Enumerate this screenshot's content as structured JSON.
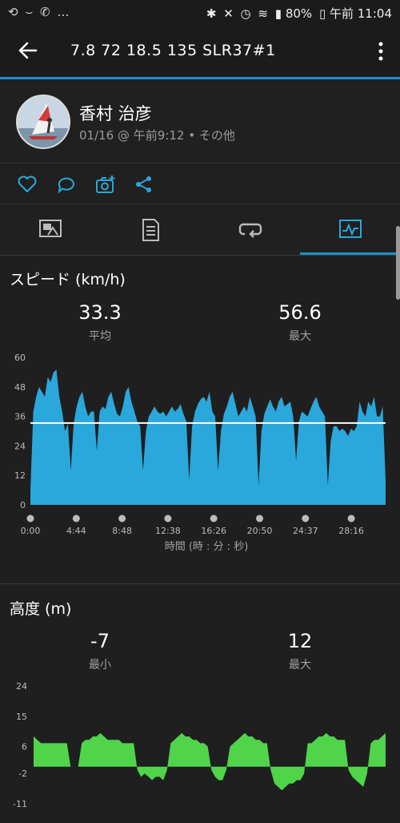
{
  "status_bar": {
    "left_icons": [
      "missed-call-icon",
      "refresh-icon",
      "call-forward-icon",
      "more-dots"
    ],
    "battery": "80%",
    "time": "午前 11:04"
  },
  "app_bar": {
    "title": "7.8  72  18.5   135  SLR37#1"
  },
  "profile": {
    "name": "香村 治彦",
    "meta": "01/16 @ 午前9:12 • その他"
  },
  "colors": {
    "accent": "#1a8fcf",
    "speed_fill": "#2aa7db",
    "elev_fill": "#4fd44a",
    "avg_line": "#ffffff"
  },
  "speed": {
    "title": "スピード (km/h)",
    "avg_value": "33.3",
    "avg_label": "平均",
    "max_value": "56.6",
    "max_label": "最大",
    "chart_data": {
      "type": "area",
      "ylim": [
        0,
        60
      ],
      "yticks": [
        "60",
        "48",
        "36",
        "24",
        "12",
        "0"
      ],
      "xticks": [
        "0:00",
        "4:44",
        "8:48",
        "12:38",
        "16:26",
        "20:50",
        "24:37",
        "28:16"
      ],
      "xlabel": "時間 (時 : 分 : 秒)",
      "average": 33.3,
      "values": [
        6,
        38,
        44,
        48,
        46,
        44,
        52,
        50,
        54,
        55,
        44,
        38,
        30,
        33,
        14,
        33,
        40,
        44,
        46,
        40,
        36,
        38,
        38,
        22,
        38,
        40,
        39,
        44,
        46,
        41,
        37,
        36,
        40,
        46,
        48,
        42,
        38,
        34,
        32,
        14,
        30,
        36,
        38,
        40,
        38,
        37,
        38,
        36,
        38,
        40,
        38,
        39,
        41,
        37,
        34,
        10,
        32,
        38,
        41,
        43,
        44,
        42,
        46,
        38,
        36,
        14,
        30,
        37,
        40,
        44,
        46,
        41,
        36,
        38,
        40,
        38,
        44,
        40,
        36,
        8,
        30,
        37,
        40,
        43,
        40,
        38,
        42,
        44,
        40,
        41,
        42,
        36,
        18,
        34,
        38,
        37,
        36,
        39,
        42,
        44,
        40,
        38,
        36,
        8,
        26,
        32,
        32,
        30,
        31,
        30,
        28,
        31,
        30,
        32,
        42,
        38,
        36,
        42,
        40,
        44,
        36,
        36,
        40,
        10
      ]
    }
  },
  "elevation": {
    "title": "高度 (m)",
    "min_value": "-7",
    "min_label": "最小",
    "max_value": "12",
    "max_label": "最大",
    "chart_data": {
      "type": "area",
      "ylim": [
        -11,
        24
      ],
      "yticks": [
        "24",
        "15",
        "6",
        "-2",
        "-11"
      ],
      "values": [
        9,
        8,
        7,
        7,
        7,
        7,
        7,
        7,
        7,
        7,
        0,
        0,
        0,
        7,
        8,
        8,
        9,
        9,
        10,
        9,
        8,
        8,
        8,
        8,
        7,
        7,
        7,
        7,
        -1,
        -3,
        -2,
        -3,
        -4,
        -3,
        -3,
        -4,
        -1,
        7,
        8,
        9,
        10,
        9,
        9,
        8,
        8,
        7,
        7,
        6,
        -1,
        -3,
        -4,
        -4,
        -1,
        6,
        7,
        8,
        9,
        10,
        9,
        9,
        8,
        8,
        7,
        7,
        -1,
        -5,
        -6,
        -7,
        -6,
        -5,
        -5,
        -4,
        -4,
        -2,
        7,
        7,
        8,
        9,
        9,
        10,
        9,
        9,
        8,
        8,
        8,
        -1,
        -3,
        -4,
        -5,
        -6,
        -2,
        7,
        8,
        8,
        9,
        10
      ]
    }
  }
}
